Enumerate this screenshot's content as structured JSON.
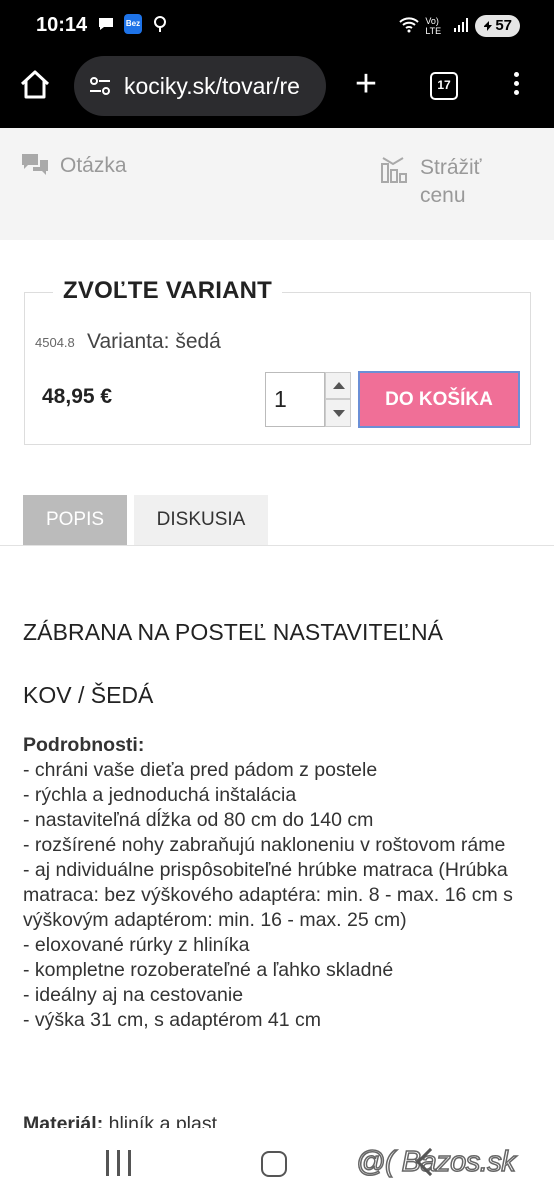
{
  "status_bar": {
    "time": "10:14",
    "app_icon_label": "Bez",
    "network": "Vo) LTE",
    "battery": "57",
    "icons": [
      "chat-bubble-icon",
      "app-icon",
      "location-icon",
      "wifi-icon",
      "signal-icon",
      "battery-icon"
    ]
  },
  "browser": {
    "url": "kociky.sk/tovar/re",
    "tabs_count": "17",
    "new_tab_glyph": "+"
  },
  "actions": {
    "question_label": "Otázka",
    "watch_price_label": "Strážiť cenu"
  },
  "variant": {
    "legend": "ZVOĽTE VARIANT",
    "code": "4504.8",
    "name": "Varianta: šedá",
    "price": "48,95 €",
    "quantity": "1",
    "add_to_cart": "DO KOŠÍKA",
    "accent_color": "#f06f97"
  },
  "tabs": [
    {
      "label": "POPIS",
      "active": true
    },
    {
      "label": "DISKUSIA",
      "active": false
    }
  ],
  "product": {
    "title": "ZÁBRANA NA POSTEĽ NASTAVITEĽNÁ",
    "subtitle": "KOV / ŠEDÁ",
    "details_heading": "Podrobnosti:",
    "details_lines": [
      "- chráni vaše dieťa pred pádom z postele",
      "- rýchla a jednoduchá inštalácia",
      "- nastaviteľná dĺžka od 80 cm do 140 cm",
      "- rozšírené nohy zabraňujú nakloneniu v roštovom ráme",
      "- aj ndividuálne prispôsobiteľné hrúbke matraca (Hrúbka matraca: bez výškového adaptéra: min. 8 - max. 16 cm s výškovým adaptérom: min. 16 - max. 25 cm)",
      "- eloxované rúrky z hliníka",
      "- kompletne rozoberateľné a ľahko skladné",
      "- ideálny aj na cestovanie",
      "- výška 31 cm, s adaptérom 41 cm"
    ],
    "material_label": "Materiál:",
    "material_value": "hliník a plast"
  },
  "watermark": "@( Bazos.sk"
}
